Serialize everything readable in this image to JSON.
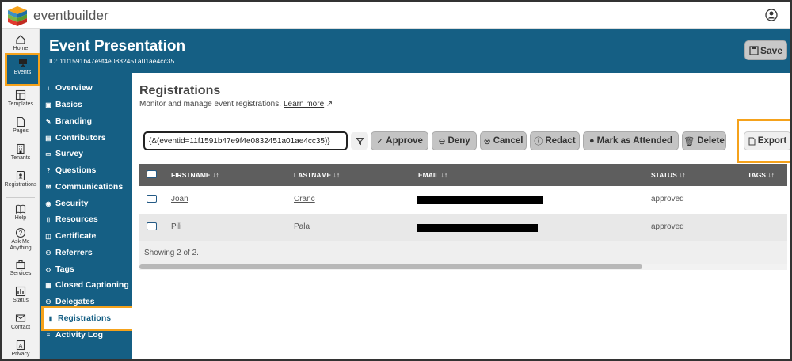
{
  "app": {
    "name": "eventbuilder"
  },
  "rail": {
    "items": [
      {
        "label": "Home",
        "icon": "home-icon"
      },
      {
        "label": "Events",
        "icon": "presentation-icon",
        "active": true
      },
      {
        "label": "Templates",
        "icon": "templates-icon"
      },
      {
        "label": "Pages",
        "icon": "page-icon"
      },
      {
        "label": "Tenants",
        "icon": "building-icon"
      },
      {
        "label": "Registrations",
        "icon": "badge-icon"
      },
      {
        "label": "Help",
        "icon": "book-icon"
      },
      {
        "label": "Ask Me Anything",
        "icon": "question-icon"
      },
      {
        "label": "Services",
        "icon": "bag-icon"
      },
      {
        "label": "Status",
        "icon": "chart-icon"
      },
      {
        "label": "Contact",
        "icon": "mail-icon"
      },
      {
        "label": "Privacy",
        "icon": "document-icon"
      }
    ]
  },
  "header": {
    "title": "Event Presentation",
    "id_line": "ID: 11f1591b47e9f4e0832451a01ae4cc35",
    "save_label": "Save"
  },
  "subnav": {
    "items": [
      {
        "label": "Overview",
        "icon": "i"
      },
      {
        "label": "Basics",
        "icon": "▣"
      },
      {
        "label": "Branding",
        "icon": "✎"
      },
      {
        "label": "Contributors",
        "icon": "▤"
      },
      {
        "label": "Survey",
        "icon": "▭"
      },
      {
        "label": "Questions",
        "icon": "?"
      },
      {
        "label": "Communications",
        "icon": "✉"
      },
      {
        "label": "Security",
        "icon": "◉"
      },
      {
        "label": "Resources",
        "icon": "▯"
      },
      {
        "label": "Certificate",
        "icon": "◫"
      },
      {
        "label": "Referrers",
        "icon": "⚇"
      },
      {
        "label": "Tags",
        "icon": "◇"
      },
      {
        "label": "Closed Captioning",
        "icon": "▦"
      },
      {
        "label": "Delegates",
        "icon": "⚇"
      },
      {
        "label": "Registrations",
        "icon": "▮",
        "active": true
      },
      {
        "label": "Activity Log",
        "icon": "≡"
      }
    ]
  },
  "content": {
    "title": "Registrations",
    "subtitle": "Monitor and manage event registrations.",
    "learn_more": "Learn more",
    "filter_value": "{&(eventid=11f1591b47e9f4e0832451a01ae4cc35)}",
    "buttons": {
      "approve": "Approve",
      "deny": "Deny",
      "cancel": "Cancel",
      "redact": "Redact",
      "attended": "Mark as Attended",
      "delete": "Delete",
      "export": "Export"
    },
    "table": {
      "columns": [
        "FIRSTNAME",
        "LASTNAME",
        "EMAIL",
        "STATUS",
        "TAGS"
      ],
      "rows": [
        {
          "firstname": "Joan",
          "lastname": "Cranc",
          "status": "approved"
        },
        {
          "firstname": "Pili",
          "lastname": "Pala",
          "status": "approved"
        }
      ],
      "footer": "Showing 2 of 2."
    }
  },
  "colors": {
    "brand": "#155f84",
    "highlight": "#f5a21b"
  }
}
